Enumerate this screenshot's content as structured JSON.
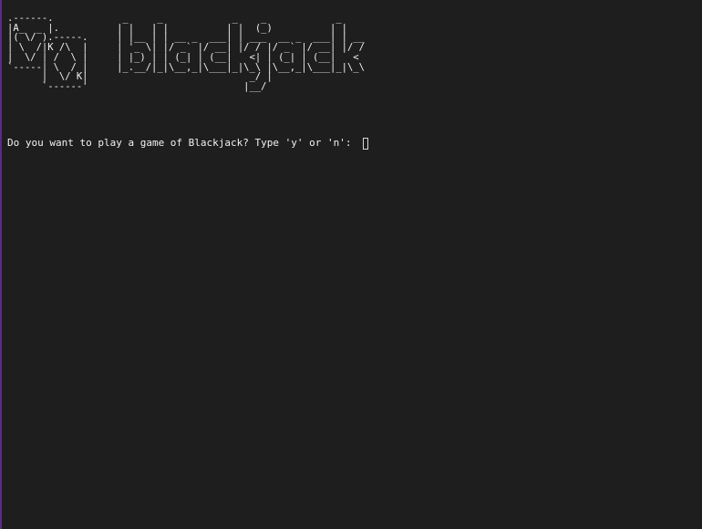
{
  "terminal": {
    "ascii_logo": ".------.            _     _            _    _            _\n|A_  _ |.          | |   | |          | |  (_)          | |\n|( \\/ ).-----.     | |__ | | __ _  ___| | ___  __ _  ___| | __\n| \\  /|K /\\  |     | '_ \\| |/ _` |/ __| |/ / |/ _` |/ __| |/ /\n|  \\/ | /  \\ |     | |_) | | (_| | (__|   <| | (_| | (__|   <\n`-----| \\  / |     |_.__/|_|\\__,_|\\___|_|\\_\\ |\\__,_|\\___|_|\\_\\\n      |  \\/ K|                            _/ |\n      `------'                           |__/",
    "prompt_text": "Do you want to play a game of Blackjack? Type 'y' or 'n': ",
    "input_value": ""
  }
}
